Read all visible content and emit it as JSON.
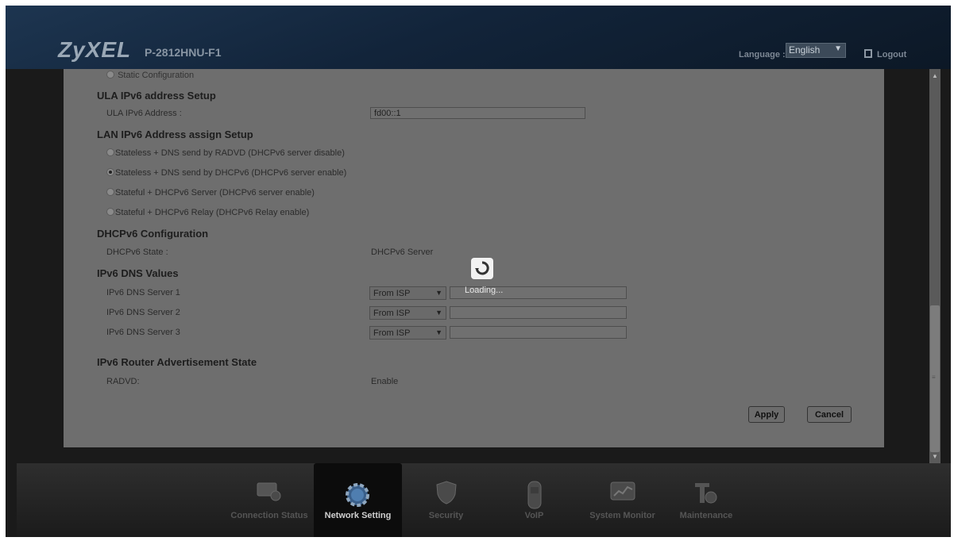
{
  "header": {
    "brand": "ZyXEL",
    "model": "P-2812HNU-F1",
    "language_label": "Language :",
    "language_value": "English",
    "logout_label": "Logout"
  },
  "content": {
    "cut_off_option": "Static Configuration",
    "ula_section": {
      "title": "ULA IPv6 address Setup",
      "address_label": "ULA IPv6 Address :",
      "address_value": "fd00::1"
    },
    "lan_assign_section": {
      "title": "LAN IPv6 Address assign Setup",
      "options": [
        {
          "label": "Stateless + DNS send by RADVD (DHCPv6 server disable)",
          "selected": false
        },
        {
          "label": "Stateless + DNS send by DHCPv6 (DHCPv6 server enable)",
          "selected": true
        },
        {
          "label": "Stateful + DHCPv6 Server (DHCPv6 server enable)",
          "selected": false
        },
        {
          "label": "Stateful + DHCPv6 Relay (DHCPv6 Relay enable)",
          "selected": false
        }
      ]
    },
    "dhcpv6_section": {
      "title": "DHCPv6 Configuration",
      "state_label": "DHCPv6 State :",
      "state_value": "DHCPv6 Server"
    },
    "dns_section": {
      "title": "IPv6 DNS Values",
      "servers": [
        {
          "label": "IPv6 DNS Server 1",
          "mode": "From ISP",
          "value": ""
        },
        {
          "label": "IPv6 DNS Server 2",
          "mode": "From ISP",
          "value": ""
        },
        {
          "label": "IPv6 DNS Server 3",
          "mode": "From ISP",
          "value": ""
        }
      ]
    },
    "ra_section": {
      "title": "IPv6 Router Advertisement State",
      "radvd_label": "RADVD:",
      "radvd_value": "Enable"
    },
    "buttons": {
      "apply": "Apply",
      "cancel": "Cancel"
    },
    "loading_text": "Loading..."
  },
  "bottom_nav": [
    {
      "label": "Connection Status",
      "icon": "monitor-icon",
      "active": false
    },
    {
      "label": "Network Setting",
      "icon": "gear-icon",
      "active": true
    },
    {
      "label": "Security",
      "icon": "shield-icon",
      "active": false
    },
    {
      "label": "VoIP",
      "icon": "phone-icon",
      "active": false
    },
    {
      "label": "System Monitor",
      "icon": "chart-icon",
      "active": false
    },
    {
      "label": "Maintenance",
      "icon": "toolbox-icon",
      "active": false
    }
  ],
  "colors": {
    "overlay_dim": "#6e6e6e",
    "header_bg": "#12243a",
    "active_tab_bg": "#0c0c0c"
  }
}
